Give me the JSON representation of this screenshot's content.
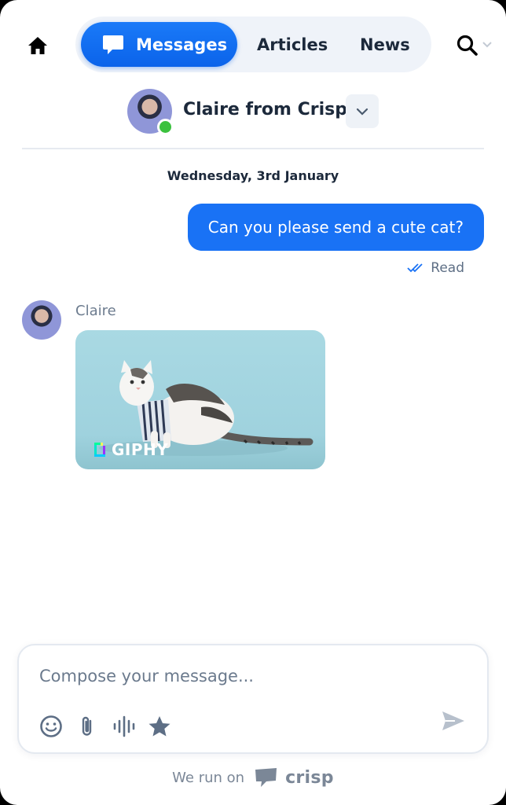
{
  "nav": {
    "tabs": [
      {
        "label": "Messages",
        "active": true,
        "icon": "chat-bubble-icon"
      },
      {
        "label": "Articles",
        "active": false
      },
      {
        "label": "News",
        "active": false
      }
    ],
    "home_icon": "home-icon",
    "search_icon": "search-icon"
  },
  "operator": {
    "name": "Claire from Crisp",
    "status": "online"
  },
  "conversation": {
    "date": "Wednesday, 3rd January",
    "messages": [
      {
        "from": "user",
        "text": "Can you please send a cute cat?",
        "status": "Read"
      },
      {
        "from": "operator",
        "sender": "Claire",
        "type": "gif",
        "gif_brand": "GIPHY"
      }
    ]
  },
  "composer": {
    "placeholder": "Compose your message...",
    "tools": [
      "emoji-icon",
      "paperclip-icon",
      "audio-wave-icon",
      "star-icon"
    ],
    "send_icon": "send-icon"
  },
  "footer": {
    "prefix": "We run on",
    "brand": "crisp"
  },
  "colors": {
    "accent": "#1972f5",
    "online": "#3bc13e",
    "text": "#1c293b"
  }
}
